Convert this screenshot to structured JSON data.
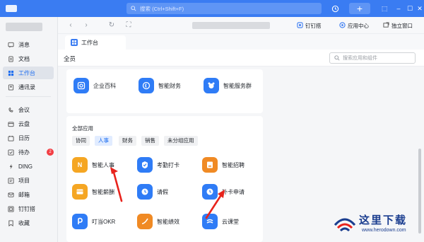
{
  "titlebar": {
    "search_placeholder": "搜索 (Ctrl+Shift+F)",
    "accent": "#3a7cf2"
  },
  "topbar": {
    "links": [
      {
        "label": "钉钉搭",
        "icon": "dingda-icon"
      },
      {
        "label": "应用中心",
        "icon": "app-center-icon"
      },
      {
        "label": "独立窗口",
        "icon": "window-icon"
      }
    ]
  },
  "tab": {
    "label": "工作台"
  },
  "sidebar": {
    "items": [
      {
        "label": "消息",
        "icon": "message-icon"
      },
      {
        "label": "文档",
        "icon": "doc-icon"
      },
      {
        "label": "工作台",
        "icon": "workbench-icon",
        "active": true
      },
      {
        "label": "通讯录",
        "icon": "contacts-icon"
      },
      {
        "label": "会议",
        "icon": "meeting-icon"
      },
      {
        "label": "云盘",
        "icon": "cloud-icon"
      },
      {
        "label": "日历",
        "icon": "calendar-icon"
      },
      {
        "label": "待办",
        "icon": "todo-icon",
        "badge": "2"
      },
      {
        "label": "DING",
        "icon": "ding-icon"
      },
      {
        "label": "项目",
        "icon": "project-icon"
      },
      {
        "label": "邮箱",
        "icon": "mail-icon"
      },
      {
        "label": "钉钉搭",
        "icon": "dingda-icon"
      },
      {
        "label": "收藏",
        "icon": "favorite-icon"
      }
    ]
  },
  "main": {
    "all_label": "全员",
    "search_placeholder": "搜索应用和组件",
    "top_apps": [
      {
        "label": "企业百科",
        "icon": "wiki-icon",
        "color": "#2f7cf6"
      },
      {
        "label": "智能财务",
        "icon": "finance-icon",
        "color": "#2f7cf6"
      },
      {
        "label": "智能服务群",
        "icon": "service-group-icon",
        "color": "#2f7cf6"
      }
    ],
    "section_title": "全部应用",
    "chips": [
      "协同",
      "人事",
      "财务",
      "销售",
      "未分组应用"
    ],
    "active_chip": "人事",
    "apps": [
      {
        "label": "智能人事",
        "icon": "hr-icon",
        "color": "#f5a623"
      },
      {
        "label": "考勤打卡",
        "icon": "attendance-icon",
        "color": "#2f7cf6"
      },
      {
        "label": "智能招聘",
        "icon": "recruit-icon",
        "color": "#f08a24"
      },
      {
        "label": "智能薪酬",
        "icon": "salary-icon",
        "color": "#f5a623"
      },
      {
        "label": "请假",
        "icon": "leave-icon",
        "color": "#2f7cf6"
      },
      {
        "label": "补卡申请",
        "icon": "card-repair-icon",
        "color": "#2f7cf6"
      },
      {
        "label": "叮当OKR",
        "icon": "okr-icon",
        "color": "#2f7cf6"
      },
      {
        "label": "智能绩效",
        "icon": "performance-icon",
        "color": "#f08a24"
      },
      {
        "label": "云课堂",
        "icon": "classroom-icon",
        "color": "#2f7cf6"
      }
    ]
  },
  "watermark": {
    "text": "这里下载",
    "url": "www.herodown.com"
  }
}
